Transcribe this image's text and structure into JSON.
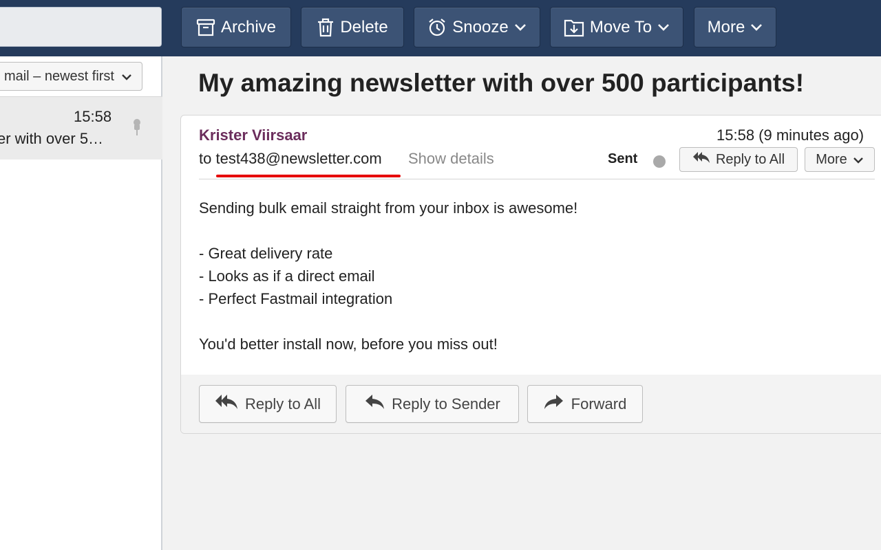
{
  "toolbar": {
    "search_value": "",
    "archive_label": "Archive",
    "delete_label": "Delete",
    "snooze_label": "Snooze",
    "move_to_label": "Move To",
    "more_label": "More",
    "icons": [
      "archive-icon",
      "trash-icon",
      "alarm-clock-icon",
      "move-to-folder-icon",
      "chevron-down-icon"
    ],
    "colors": {
      "bar": "#253b5c",
      "button": "#3c5375"
    }
  },
  "list": {
    "sort_label": "mail – newest first",
    "items": [
      {
        "time": "15:58",
        "snippet": "er with over 5…"
      }
    ]
  },
  "message": {
    "subject": "My amazing newsletter with over 500 participants!",
    "sender": "Krister Viirsaar",
    "time": "15:58 (9 minutes ago)",
    "to_prefix": "to",
    "to_address": "test438@newsletter.com",
    "show_details": "Show details",
    "status": "Sent",
    "reply_all_label": "Reply to All",
    "more_label": "More",
    "body": [
      "Sending bulk email straight from your inbox is awesome!",
      "",
      "- Great delivery rate",
      "- Looks as if a direct email",
      "- Perfect Fastmail integration",
      "",
      "You'd better install now, before you miss out!"
    ],
    "colors": {
      "sender": "#6b2d5c",
      "annotation_underline": "#e60000"
    }
  },
  "actions": {
    "reply_all": "Reply to All",
    "reply_sender": "Reply to Sender",
    "forward": "Forward"
  }
}
